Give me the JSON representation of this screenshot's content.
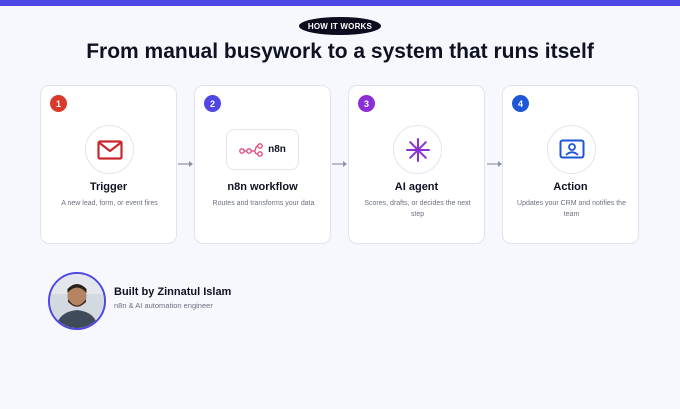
{
  "eyebrow": "HOW IT WORKS",
  "headline": "From manual busywork to a system that runs itself",
  "steps": [
    {
      "number": "1",
      "title": "Trigger",
      "description": "A new lead, form, or event fires",
      "icon": "mail-icon",
      "badge_color": "#d93a2b"
    },
    {
      "number": "2",
      "title": "n8n workflow",
      "description": "Routes and transforms your data",
      "icon": "n8n-logo-icon",
      "logo_text": "n8n",
      "badge_color": "#4f46e5"
    },
    {
      "number": "3",
      "title": "AI agent",
      "description": "Scores, drafts, or decides the next step",
      "icon": "sparkle-icon",
      "badge_color": "#8b2fd6"
    },
    {
      "number": "4",
      "title": "Action",
      "description": "Updates your CRM and notifies the team",
      "icon": "contact-card-icon",
      "badge_color": "#1d56d6"
    }
  ],
  "author": {
    "name": "Built by Zinnatul Islam",
    "role": "n8n & AI automation engineer"
  },
  "colors": {
    "accent": "#4f46e5",
    "background": "#f7f8fd",
    "heading": "#0f1222"
  }
}
